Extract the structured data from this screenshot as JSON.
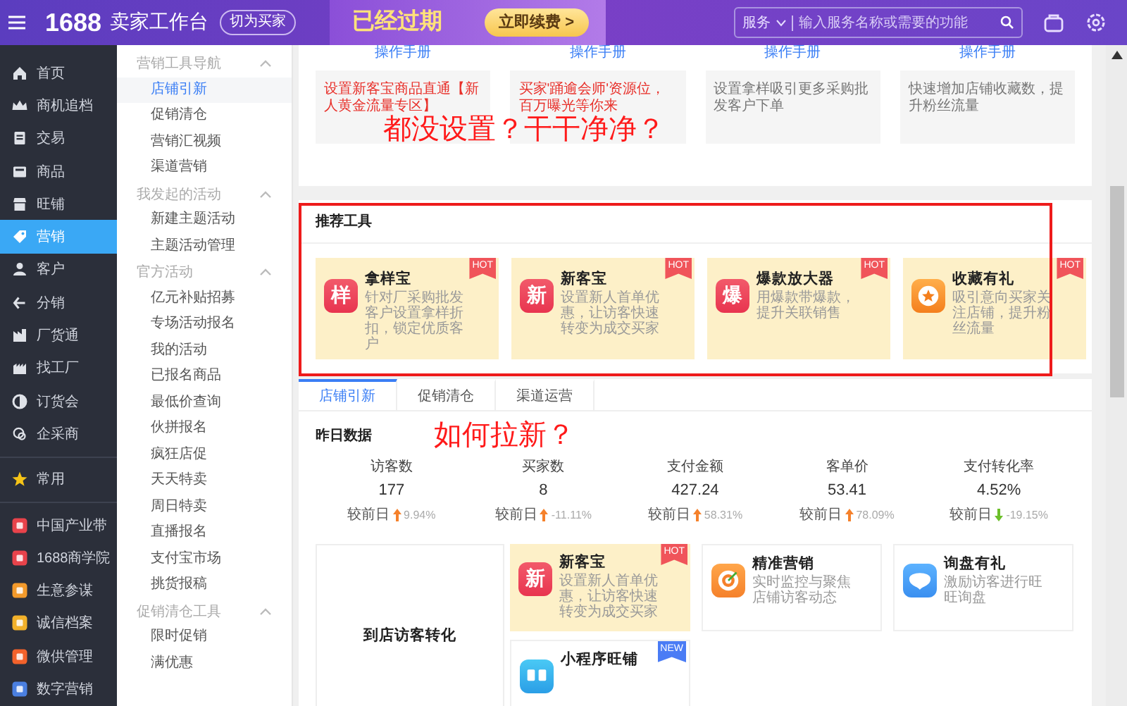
{
  "top_bar": {
    "logo_number": "1688",
    "logo_text": "卖家工作台",
    "switch_button": "切为买家",
    "banner": {
      "headline": "已经过期",
      "button": "立即续费 >"
    },
    "search": {
      "scope": "服务",
      "placeholder": "输入服务名称或需要的功能"
    }
  },
  "sidebar": {
    "items": [
      {
        "label": "首页",
        "kind": "nav",
        "selected": false
      },
      {
        "label": "商机追档",
        "kind": "nav",
        "selected": false
      },
      {
        "label": "交易",
        "kind": "nav",
        "selected": false
      },
      {
        "label": "商品",
        "kind": "nav",
        "selected": false
      },
      {
        "label": "旺铺",
        "kind": "nav",
        "selected": false
      },
      {
        "label": "营销",
        "kind": "nav",
        "selected": true
      },
      {
        "label": "客户",
        "kind": "nav",
        "selected": false
      },
      {
        "label": "分销",
        "kind": "nav",
        "selected": false
      },
      {
        "label": "厂货通",
        "kind": "nav",
        "selected": false
      },
      {
        "label": "找工厂",
        "kind": "nav",
        "selected": false
      },
      {
        "label": "订货会",
        "kind": "nav",
        "selected": false
      },
      {
        "label": "企采商",
        "kind": "nav",
        "selected": false
      },
      {
        "label": "常用",
        "kind": "favorite",
        "selected": false
      },
      {
        "label": "中国产业带",
        "kind": "app",
        "color": "#e8434b",
        "selected": false
      },
      {
        "label": "1688商学院",
        "kind": "app",
        "color": "#e8434b",
        "selected": false
      },
      {
        "label": "生意参谋",
        "kind": "app",
        "color": "#f39a2b",
        "selected": false
      },
      {
        "label": "诚信档案",
        "kind": "app",
        "color": "#f2b12a",
        "selected": false
      },
      {
        "label": "微供管理",
        "kind": "app",
        "color": "#f2622b",
        "selected": false
      },
      {
        "label": "数字营销",
        "kind": "app",
        "color": "#4a7fe0",
        "selected": false
      }
    ]
  },
  "subnav": {
    "groups": [
      {
        "title": "营销工具导航",
        "expanded": true,
        "items": [
          {
            "label": "店铺引新",
            "selected": true
          },
          {
            "label": "促销清仓",
            "selected": false
          },
          {
            "label": "营销汇视频",
            "selected": false
          },
          {
            "label": "渠道营销",
            "selected": false
          }
        ]
      },
      {
        "title": "我发起的活动",
        "expanded": true,
        "items": [
          {
            "label": "新建主题活动",
            "selected": false
          },
          {
            "label": "主题活动管理",
            "selected": false
          }
        ]
      },
      {
        "title": "官方活动",
        "expanded": true,
        "items": [
          {
            "label": "亿元补贴招募",
            "selected": false
          },
          {
            "label": "专场活动报名",
            "selected": false
          },
          {
            "label": "我的活动",
            "selected": false
          },
          {
            "label": "已报名商品",
            "selected": false
          },
          {
            "label": "最低价查询",
            "selected": false
          },
          {
            "label": "伙拼报名",
            "selected": false
          },
          {
            "label": "疯狂店促",
            "selected": false
          },
          {
            "label": "天天特卖",
            "selected": false
          },
          {
            "label": "周日特卖",
            "selected": false
          },
          {
            "label": "直播报名",
            "selected": false
          },
          {
            "label": "支付宝市场",
            "selected": false
          },
          {
            "label": "挑货报稿",
            "selected": false
          }
        ]
      },
      {
        "title": "促销清仓工具",
        "expanded": true,
        "items": [
          {
            "label": "限时促销",
            "selected": false
          },
          {
            "label": "满优惠",
            "selected": false
          }
        ]
      }
    ]
  },
  "top_cards": {
    "annotation": "都没设置？干干净净？",
    "cards": [
      {
        "link": "操作手册",
        "description": "设置新客宝商品直通【新人黄金流量专区】",
        "highlight": true
      },
      {
        "link": "操作手册",
        "description": "买家'踊逾会师'资源位，百万曝光等你来",
        "highlight": true
      },
      {
        "link": "操作手册",
        "description": "设置拿样吸引更多采购批发客户下单",
        "highlight": false
      },
      {
        "link": "操作手册",
        "description": "快速增加店铺收藏数，提升粉丝流量",
        "highlight": false
      }
    ]
  },
  "recommended_tools": {
    "title": "推荐工具",
    "highlighted": true,
    "tools": [
      {
        "name": "拿样宝",
        "description": "针对厂采购批发客户设置拿样折扣，锁定优质客户",
        "kind": "glyph",
        "icon_text": "样",
        "badge": "HOT"
      },
      {
        "name": "新客宝",
        "description": "设置新人首单优惠，让访客快速转变为成交买家",
        "kind": "glyph",
        "icon_text": "新",
        "badge": "HOT"
      },
      {
        "name": "爆款放大器",
        "description": "用爆款带爆款，提升关联销售",
        "kind": "glyph",
        "icon_text": "爆",
        "badge": "HOT"
      },
      {
        "name": "收藏有礼",
        "description": "吸引意向买家关注店铺，提升粉丝流量",
        "kind": "star",
        "badge": "HOT"
      }
    ]
  },
  "tabs": [
    {
      "label": "店铺引新",
      "selected": true
    },
    {
      "label": "促销清仓",
      "selected": false
    },
    {
      "label": "渠道运营",
      "selected": false
    }
  ],
  "yesterday": {
    "title": "昨日数据",
    "annotation": "如何拉新？",
    "stats": [
      {
        "label": "访客数",
        "value": "177",
        "compare_label": "较前日",
        "kind": "up",
        "change": "9.94%"
      },
      {
        "label": "买家数",
        "value": "8",
        "compare_label": "较前日",
        "kind": "up",
        "change": "-11.11%"
      },
      {
        "label": "支付金额",
        "value": "427.24",
        "compare_label": "较前日",
        "kind": "up",
        "change": "58.31%"
      },
      {
        "label": "客单价",
        "value": "53.41",
        "compare_label": "较前日",
        "kind": "up",
        "change": "78.09%"
      },
      {
        "label": "支付转化率",
        "value": "4.52%",
        "compare_label": "较前日",
        "kind": "down",
        "change": "-19.15%"
      }
    ]
  },
  "conversion": {
    "title": "到店访客转化",
    "tools": [
      {
        "name": "新客宝",
        "description": "设置新人首单优惠，让访客快速转变为成交买家",
        "kind": "glyph",
        "icon_text": "新",
        "badge": "HOT"
      },
      {
        "name": "精准营销",
        "description": "实时监控与聚焦店铺访客动态",
        "kind": "target"
      },
      {
        "name": "询盘有礼",
        "description": "激励访客进行旺旺询盘",
        "kind": "chat"
      },
      {
        "name": "小程序旺铺",
        "kind": "grid",
        "badge": "NEW"
      }
    ]
  }
}
